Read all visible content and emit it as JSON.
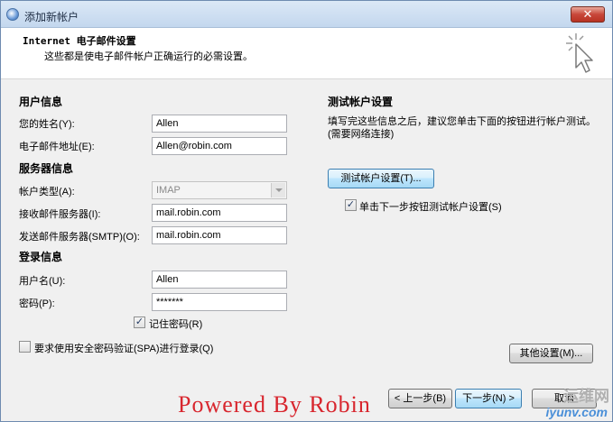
{
  "window": {
    "title": "添加新帐户",
    "close_glyph": "✕"
  },
  "header": {
    "title": "Internet 电子邮件设置",
    "subtitle": "这些都是使电子邮件帐户正确运行的必需设置。"
  },
  "user_info": {
    "section": "用户信息",
    "name_label": "您的姓名(Y):",
    "name_value": "Allen",
    "email_label": "电子邮件地址(E):",
    "email_value": "Allen@robin.com"
  },
  "server_info": {
    "section": "服务器信息",
    "account_type_label": "帐户类型(A):",
    "account_type_value": "IMAP",
    "incoming_label": "接收邮件服务器(I):",
    "incoming_value": "mail.robin.com",
    "outgoing_label": "发送邮件服务器(SMTP)(O):",
    "outgoing_value": "mail.robin.com"
  },
  "login_info": {
    "section": "登录信息",
    "username_label": "用户名(U):",
    "username_value": "Allen",
    "password_label": "密码(P):",
    "password_value": "*******",
    "remember_label": "记住密码(R)",
    "remember_checked": true,
    "spa_label": "要求使用安全密码验证(SPA)进行登录(Q)",
    "spa_checked": false
  },
  "test_settings": {
    "section": "测试帐户设置",
    "description": "填写完这些信息之后，建议您单击下面的按钮进行帐户测试。(需要网络连接)",
    "test_button": "测试帐户设置(T)...",
    "auto_test_label": "单击下一步按钮测试帐户设置(S)",
    "auto_test_checked": true
  },
  "more_settings_button": "其他设置(M)...",
  "nav": {
    "back": "< 上一步(B)",
    "next": "下一步(N) >",
    "cancel": "取消"
  },
  "check_glyph": "✓",
  "watermark": "Powered By Robin",
  "site_logo": {
    "top": "运维网",
    "bottom": "iyunv.com"
  }
}
